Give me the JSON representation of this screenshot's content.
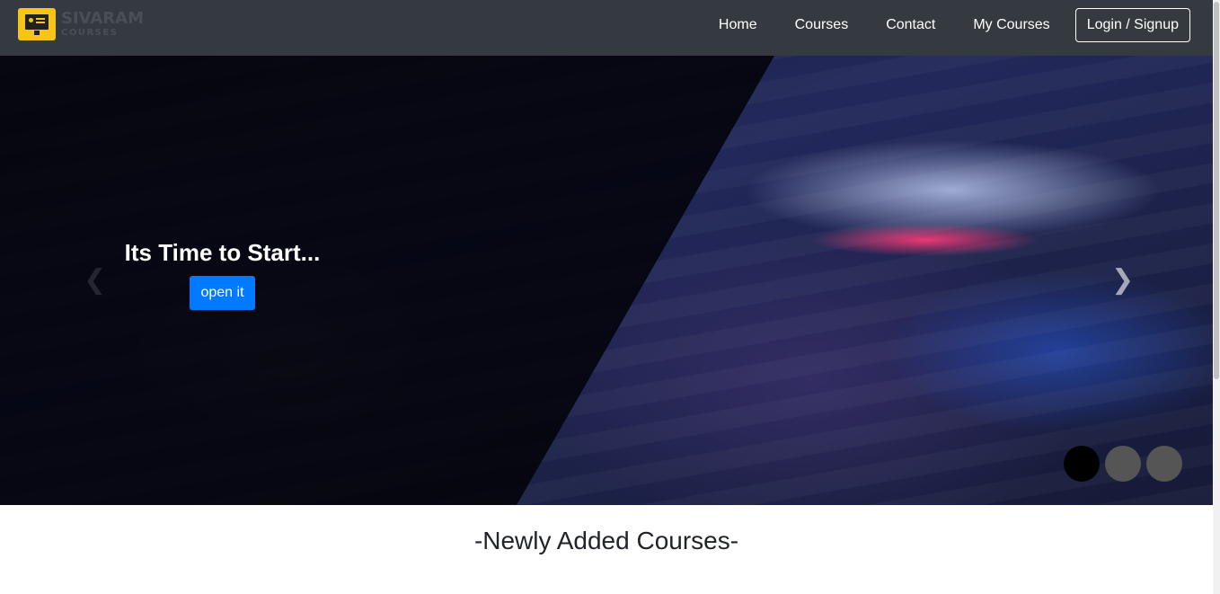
{
  "brand": {
    "name": "SIVARAM",
    "sub": "COURSES",
    "accent": "#f5c518"
  },
  "nav": {
    "links": [
      "Home",
      "Courses",
      "Contact",
      "My Courses"
    ],
    "login_label": "Login / Signup"
  },
  "carousel": {
    "caption_title": "Its Time to Start...",
    "button_label": "open it",
    "prev_icon": "chevron-left",
    "next_icon": "chevron-right",
    "slide_count": 3,
    "active_index": 0
  },
  "section": {
    "title": "-Newly Added Courses-"
  },
  "colors": {
    "navbar": "#343a40",
    "primary_button": "#007bff"
  }
}
